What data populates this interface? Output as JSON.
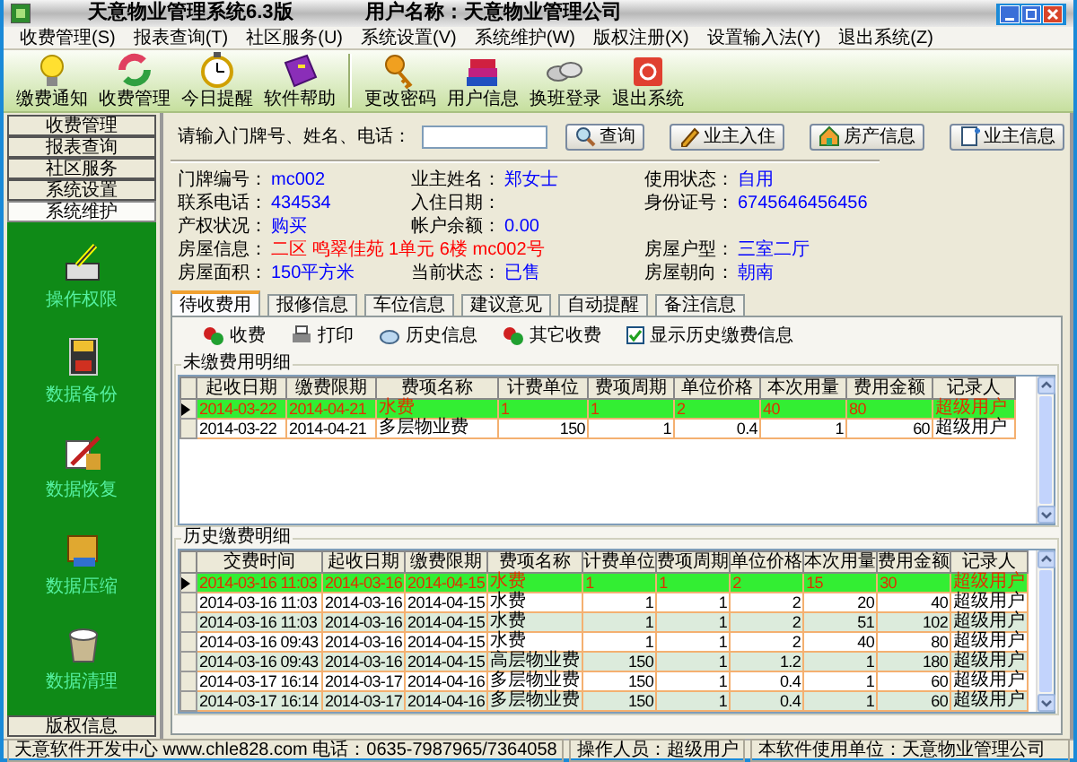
{
  "window": {
    "title": "天意物业管理系统6.3版",
    "user": "用户名称：天意物业管理公司"
  },
  "menu": [
    "收费管理(S)",
    "报表查询(T)",
    "社区服务(U)",
    "系统设置(V)",
    "系统维护(W)",
    "版权注册(X)",
    "设置输入法(Y)",
    "退出系统(Z)"
  ],
  "toolbar": [
    "缴费通知",
    "收费管理",
    "今日提醒",
    "软件帮助",
    "更改密码",
    "用户信息",
    "换班登录",
    "退出系统"
  ],
  "sidebar": {
    "sections": [
      {
        "label": "收费管理",
        "selected": false
      },
      {
        "label": "报表查询",
        "selected": false
      },
      {
        "label": "社区服务",
        "selected": false
      },
      {
        "label": "系统设置",
        "selected": false
      },
      {
        "label": "系统维护",
        "selected": true
      }
    ],
    "tools": [
      "操作权限",
      "数据备份",
      "数据恢复",
      "数据压缩",
      "数据清理"
    ],
    "footer": "版权信息"
  },
  "search": {
    "label": "请输入门牌号、姓名、电话："
  },
  "actions": [
    "查询",
    "业主入住",
    "房产信息",
    "业主信息"
  ],
  "details": [
    [
      {
        "label": "门牌编号：",
        "value": "mc002",
        "color": "#0000ff"
      },
      {
        "label": "业主姓名：",
        "value": "郑女士",
        "color": "#0000ff"
      },
      {
        "label": "使用状态：",
        "value": "自用",
        "color": "#0000ff"
      }
    ],
    [
      {
        "label": "联系电话：",
        "value": "434534",
        "color": "#0000ff"
      },
      {
        "label": "入住日期："
      },
      {
        "label": "身份证号：",
        "value": "6745646456456",
        "color": "#0000ff"
      }
    ],
    [
      {
        "label": "产权状况：",
        "value": "购买",
        "color": "#0000ff"
      },
      {
        "label": "帐户余额：",
        "value": "0.00",
        "color": "#0000ff"
      }
    ],
    [
      {
        "label": "房屋信息：",
        "value": "二区 鸣翠佳苑 1单元 6楼 mc002号",
        "color": "#ff0000",
        "kind": "wide"
      },
      {
        "label": "房屋户型：",
        "value": "三室二厅",
        "color": "#0000ff"
      }
    ],
    [
      {
        "label": "房屋面积：",
        "value": "150平方米",
        "color": "#0000ff"
      },
      {
        "label": "当前状态：",
        "value": "已售",
        "color": "#0000ff"
      },
      {
        "label": "房屋朝向：",
        "value": "朝南",
        "color": "#0000ff"
      }
    ]
  ],
  "tabs": [
    {
      "label": "待收费用",
      "selected": true
    },
    {
      "label": "报修信息",
      "selected": false
    },
    {
      "label": "车位信息",
      "selected": false
    },
    {
      "label": "建议意见",
      "selected": false
    },
    {
      "label": "自动提醒",
      "selected": false
    },
    {
      "label": "备注信息",
      "selected": false
    }
  ],
  "fee_toolbar": {
    "buttons": [
      "收费",
      "打印",
      "历史信息",
      "其它收费"
    ],
    "checkbox": {
      "label": "显示历史缴费信息",
      "checked": true
    }
  },
  "unpaid": {
    "title": "未缴费用明细",
    "columns": [
      "起收日期",
      "缴费限期",
      "费项名称",
      "计费单位",
      "费项周期",
      "单位价格",
      "本次用量",
      "费用金额",
      "记录人"
    ],
    "rows": [
      {
        "selected": true,
        "cells": [
          "2014-03-22",
          "2014-04-21",
          "水费",
          "1",
          "1",
          "2",
          "40",
          "80",
          "超级用户"
        ]
      },
      {
        "selected": false,
        "cells": [
          "2014-03-22",
          "2014-04-21",
          "多层物业费",
          "150",
          "1",
          "0.4",
          "1",
          "60",
          "超级用户"
        ]
      }
    ]
  },
  "history": {
    "title": "历史缴费明细",
    "columns": [
      "交费时间",
      "起收日期",
      "缴费限期",
      "费项名称",
      "计费单位",
      "费项周期",
      "单位价格",
      "本次用量",
      "费用金额",
      "记录人"
    ],
    "rows": [
      {
        "selected": true,
        "cells": [
          "2014-03-16 11:03",
          "2014-03-16",
          "2014-04-15",
          "水费",
          "1",
          "1",
          "2",
          "15",
          "30",
          "超级用户"
        ]
      },
      {
        "selected": false,
        "cells": [
          "2014-03-16 11:03",
          "2014-03-16",
          "2014-04-15",
          "水费",
          "1",
          "1",
          "2",
          "20",
          "40",
          "超级用户"
        ]
      },
      {
        "selected": false,
        "cells": [
          "2014-03-16 11:03",
          "2014-03-16",
          "2014-04-15",
          "水费",
          "1",
          "1",
          "2",
          "51",
          "102",
          "超级用户"
        ]
      },
      {
        "selected": false,
        "cells": [
          "2014-03-16 09:43",
          "2014-03-16",
          "2014-04-15",
          "水费",
          "1",
          "1",
          "2",
          "40",
          "80",
          "超级用户"
        ]
      },
      {
        "selected": false,
        "cells": [
          "2014-03-16 09:43",
          "2014-03-16",
          "2014-04-15",
          "高层物业费",
          "150",
          "1",
          "1.2",
          "1",
          "180",
          "超级用户"
        ]
      },
      {
        "selected": false,
        "cells": [
          "2014-03-17 16:14",
          "2014-03-17",
          "2014-04-16",
          "多层物业费",
          "150",
          "1",
          "0.4",
          "1",
          "60",
          "超级用户"
        ]
      },
      {
        "selected": false,
        "cells": [
          "2014-03-17 16:14",
          "2014-03-17",
          "2014-04-16",
          "多层物业费",
          "150",
          "1",
          "0.4",
          "1",
          "60",
          "超级用户"
        ]
      }
    ]
  },
  "status_bar": [
    "天意软件开发中心 www.chle828.com 电话：0635-7987965/7364058",
    "操作人员：超级用户",
    "本软件使用单位：天意物业管理公司"
  ]
}
